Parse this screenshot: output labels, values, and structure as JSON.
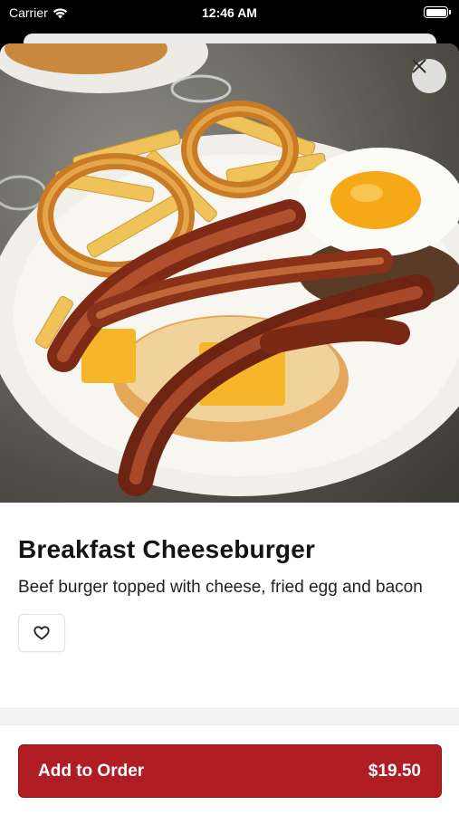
{
  "status_bar": {
    "carrier": "Carrier",
    "time": "12:46 AM"
  },
  "item": {
    "image_icon": "food-photo",
    "title": "Breakfast Cheeseburger",
    "description": "Beef burger topped with cheese, fried egg and bacon"
  },
  "actions": {
    "close_icon": "close-icon",
    "favorite_icon": "heart-outline-icon",
    "add_label": "Add to Order",
    "price": "$19.50"
  },
  "colors": {
    "primary": "#b01e24",
    "text": "#141414"
  }
}
